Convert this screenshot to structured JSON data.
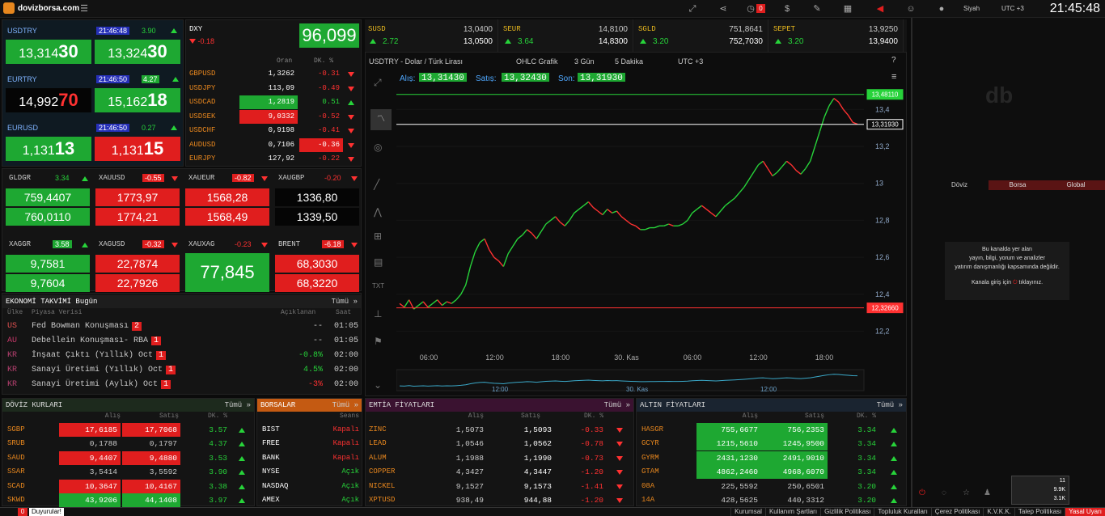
{
  "top": {
    "site": "dovizborsa.com",
    "theme": "Siyah",
    "tz": "UTC +3",
    "clock": "21:45:48",
    "alert_count": "0"
  },
  "usdtry": {
    "name": "USDTRY",
    "time": "21:46:48",
    "chg": "3.90",
    "bid_a": "13,314",
    "bid_b": "30",
    "ask_a": "13,324",
    "ask_b": "30"
  },
  "eurtry": {
    "name": "EURTRY",
    "time": "21:46:50",
    "chg": "4.27",
    "bid_a": "14,992",
    "bid_b": "70",
    "ask_a": "15,162",
    "ask_b": "18"
  },
  "eurusd": {
    "name": "EURUSD",
    "time": "21:46:50",
    "chg": "0.27",
    "bid_a": "1,131",
    "bid_b": "13",
    "ask_a": "1,131",
    "ask_b": "15"
  },
  "dxy": {
    "name": "DXY",
    "chg": "-0.18",
    "value": "96,099",
    "col_rate": "Oran",
    "col_chg": "DK. %"
  },
  "pairs": [
    {
      "n": "GBPUSD",
      "v": "1,3262",
      "c": "-0.31",
      "d": "dn",
      "hl": ""
    },
    {
      "n": "USDJPY",
      "v": "113,09",
      "c": "-0.49",
      "d": "dn",
      "hl": ""
    },
    {
      "n": "USDCAD",
      "v": "1,2819",
      "c": "0.51",
      "d": "up",
      "hl": "g"
    },
    {
      "n": "USDSEK",
      "v": "9,0332",
      "c": "-0.52",
      "d": "dn",
      "hl": "r"
    },
    {
      "n": "USDCHF",
      "v": "0,9198",
      "c": "-0.41",
      "d": "dn",
      "hl": ""
    },
    {
      "n": "AUDUSD",
      "v": "0,7106",
      "c": "-0.36",
      "d": "dn",
      "hl": "rc"
    },
    {
      "n": "EURJPY",
      "v": "127,92",
      "c": "-0.22",
      "d": "dn",
      "hl": ""
    }
  ],
  "metals": [
    {
      "n": "GLDGR",
      "c": "3.34",
      "d": "up",
      "b": "759,4407",
      "a": "760,0110",
      "cls": "g"
    },
    {
      "n": "XAUUSD",
      "c": "-0.55",
      "d": "dn",
      "b": "1773,97",
      "a": "1774,21",
      "cls": "r"
    },
    {
      "n": "XAUEUR",
      "c": "-0.82",
      "d": "dn",
      "b": "1568,28",
      "a": "1568,49",
      "cls": "r"
    },
    {
      "n": "XAUGBP",
      "c": "-0.20",
      "d": "dn",
      "b": "1336,80",
      "a": "1339,50",
      "cls": "k"
    }
  ],
  "metals2": [
    {
      "n": "XAGGR",
      "c": "3.58",
      "d": "up",
      "b": "9,7581",
      "a": "9,7604",
      "cls": "g"
    },
    {
      "n": "XAGUSD",
      "c": "-0.32",
      "d": "dn",
      "b": "22,7874",
      "a": "22,7926",
      "cls": "r"
    },
    {
      "n": "XAUXAG",
      "c": "-0.23",
      "d": "dn",
      "single": "77,845",
      "cls": "g"
    },
    {
      "n": "BRENT",
      "c": "-6.18",
      "d": "dn",
      "b": "68,3030",
      "a": "68,3220",
      "cls": "r"
    }
  ],
  "calendar": {
    "title": "EKONOMİ TAKVİMİ Bugün",
    "more": "Tümü »",
    "cols": [
      "Ülke",
      "Piyasa Verisi",
      "Açıklanan",
      "Saat"
    ],
    "rows": [
      {
        "c": "US",
        "e": "Fed Bowman Konuşması",
        "i": "2",
        "v": "--",
        "t": "01:05",
        "vc": ""
      },
      {
        "c": "AU",
        "e": "Debellein Konuşması- RBA",
        "i": "1",
        "v": "--",
        "t": "01:05",
        "vc": ""
      },
      {
        "c": "KR",
        "e": "İnşaat Çıktı (Yıllık) Oct",
        "i": "1",
        "v": "-0.8%",
        "t": "02:00",
        "vc": "up"
      },
      {
        "c": "KR",
        "e": "Sanayi Üretimi (Yıllık) Oct",
        "i": "1",
        "v": "4.5%",
        "t": "02:00",
        "vc": "up"
      },
      {
        "c": "KR",
        "e": "Sanayi Üretimi (Aylık) Oct",
        "i": "1",
        "v": "-3%",
        "t": "02:00",
        "vc": "dn"
      }
    ]
  },
  "quotes": [
    {
      "n": "SUSD",
      "c": "2.72",
      "v1": "13,0400",
      "v2": "13,0500"
    },
    {
      "n": "SEUR",
      "c": "3.64",
      "v1": "14,8100",
      "v2": "14,8300"
    },
    {
      "n": "SGLD",
      "c": "3.20",
      "v1": "751,8641",
      "v2": "752,7030"
    },
    {
      "n": "SEPET",
      "c": "3.20",
      "v1": "13,9250",
      "v2": "13,9400"
    }
  ],
  "chart_hdr": {
    "symbol": "USDTRY - Dolar / Türk Lirası",
    "type": "OHLC Grafik",
    "range": "3 Gün",
    "interval": "5 Dakika",
    "tz": "UTC +3",
    "bid_l": "Alış:",
    "bid": "13,31430",
    "ask_l": "Satış:",
    "ask": "13,32430",
    "last_l": "Son:",
    "last": "13,31930"
  },
  "chart_data": {
    "type": "line",
    "title": "USDTRY - Dolar / Türk Lirası",
    "xlabel": "",
    "ylabel": "",
    "x_ticks": [
      "06:00",
      "12:00",
      "18:00",
      "30. Kas",
      "06:00",
      "12:00",
      "18:00"
    ],
    "y_ticks": [
      "13,4",
      "13,2",
      "13",
      "12,8",
      "12,6",
      "12,4",
      "12,2"
    ],
    "ylim": [
      12.15,
      13.55
    ],
    "hlines": [
      {
        "label": "13,48110",
        "value": 13.4811
      },
      {
        "label": "13,31930",
        "value": 13.3193
      },
      {
        "label": "12,32660",
        "value": 12.3266
      }
    ],
    "series": [
      {
        "name": "",
        "values": [
          12.35,
          12.33,
          12.37,
          12.32,
          12.34,
          12.36,
          12.33,
          12.35,
          12.37,
          12.34,
          12.36,
          12.35,
          12.37,
          12.4,
          12.45,
          12.55,
          12.63,
          12.68,
          12.7,
          12.64,
          12.6,
          12.58,
          12.55,
          12.62,
          12.66,
          12.7,
          12.72,
          12.75,
          12.73,
          12.7,
          12.74,
          12.78,
          12.8,
          12.82,
          12.79,
          12.77,
          12.8,
          12.84,
          12.86,
          12.88,
          12.9,
          12.87,
          12.85,
          12.83,
          12.86,
          12.84,
          12.85,
          12.82,
          12.8,
          12.78,
          12.77,
          12.75,
          12.75,
          12.76,
          12.76,
          12.77,
          12.77,
          12.78,
          12.77,
          12.77,
          12.78,
          12.8,
          12.84,
          12.86,
          12.88,
          12.86,
          12.84,
          12.82,
          12.85,
          12.88,
          12.9,
          12.92,
          12.95,
          12.98,
          13.02,
          13.06,
          13.1,
          13.12,
          13.08,
          13.04,
          13.06,
          13.09,
          13.12,
          13.1,
          13.07,
          13.05,
          13.08,
          13.12,
          13.2,
          13.28,
          13.36,
          13.42,
          13.46,
          13.44,
          13.4,
          13.37,
          13.33,
          13.32
        ]
      }
    ],
    "navigator_ticks": [
      "12:00",
      "30. Kas",
      "12:00"
    ]
  },
  "sections": {
    "doviz": {
      "title": "DÖVİZ KURLARI",
      "more": "Tümü »",
      "cols": [
        "Alış",
        "Satış",
        "DK. %"
      ],
      "rows": [
        {
          "n": "SGBP",
          "b": "17,6185",
          "a": "17,7068",
          "c": "3.57",
          "cls": "r"
        },
        {
          "n": "SRUB",
          "b": "0,1788",
          "a": "0,1797",
          "c": "4.37",
          "cls": ""
        },
        {
          "n": "SAUD",
          "b": "9,4407",
          "a": "9,4880",
          "c": "3.53",
          "cls": "r"
        },
        {
          "n": "SSAR",
          "b": "3,5414",
          "a": "3,5592",
          "c": "3.90",
          "cls": ""
        },
        {
          "n": "SCAD",
          "b": "10,3647",
          "a": "10,4167",
          "c": "3.38",
          "cls": "r"
        },
        {
          "n": "SKWD",
          "b": "43,9206",
          "a": "44,1408",
          "c": "3.97",
          "cls": "g"
        }
      ]
    },
    "borsalar": {
      "title": "BORSALAR",
      "more": "Tümü »",
      "col": "Seans",
      "rows": [
        {
          "n": "BIST",
          "s": "Kapalı",
          "d": "dn"
        },
        {
          "n": "FREE",
          "s": "Kapalı",
          "d": "dn"
        },
        {
          "n": "BANK",
          "s": "Kapalı",
          "d": "dn"
        },
        {
          "n": "NYSE",
          "s": "Açık",
          "d": "up"
        },
        {
          "n": "NASDAQ",
          "s": "Açık",
          "d": "up"
        },
        {
          "n": "AMEX",
          "s": "Açık",
          "d": "up"
        }
      ]
    },
    "emtia": {
      "title": "EMTİA FİYATLARI",
      "more": "Tümü »",
      "cols": [
        "Alış",
        "Satış",
        "DK. %"
      ],
      "rows": [
        {
          "n": "ZINC",
          "b": "1,5073",
          "a": "1,5093",
          "c": "-0.33"
        },
        {
          "n": "LEAD",
          "b": "1,0546",
          "a": "1,0562",
          "c": "-0.78"
        },
        {
          "n": "ALUM",
          "b": "1,1988",
          "a": "1,1990",
          "c": "-0.73"
        },
        {
          "n": "COPPER",
          "b": "4,3427",
          "a": "4,3447",
          "c": "-1.20"
        },
        {
          "n": "NICKEL",
          "b": "9,1527",
          "a": "9,1573",
          "c": "-1.41"
        },
        {
          "n": "XPTUSD",
          "b": "938,49",
          "a": "944,88",
          "c": "-1.20"
        }
      ]
    },
    "altin": {
      "title": "ALTIN FİYATLARI",
      "more": "Tümü »",
      "cols": [
        "Alış",
        "Satış",
        "DK. %"
      ],
      "rows": [
        {
          "n": "HASGR",
          "b": "755,6677",
          "a": "756,2353",
          "c": "3.34",
          "cls": "g"
        },
        {
          "n": "GCYR",
          "b": "1215,5610",
          "a": "1245,9500",
          "c": "3.34",
          "cls": "g"
        },
        {
          "n": "GYRM",
          "b": "2431,1230",
          "a": "2491,9010",
          "c": "3.34",
          "cls": "g"
        },
        {
          "n": "GTAM",
          "b": "4862,2460",
          "a": "4968,6070",
          "c": "3.34",
          "cls": "g"
        },
        {
          "n": "08A",
          "b": "225,5592",
          "a": "250,6501",
          "c": "3.20",
          "cls": ""
        },
        {
          "n": "14A",
          "b": "428,5625",
          "a": "440,3312",
          "c": "3.20",
          "cls": ""
        }
      ]
    }
  },
  "chat": {
    "tabs": [
      "Döviz",
      "Borsa",
      "Global"
    ],
    "notice": [
      "Bu kanalda yer alan",
      "yayın, bilgi, yorum ve analizler",
      "yatırım danışmanlığı kapsamında değildir."
    ],
    "login": "Kanala giriş için",
    "login2": "tıklayınız."
  },
  "tray": {
    "a": "11",
    "b": "9.9K",
    "c": "3.1K"
  },
  "footer": {
    "count": "0",
    "ann": "Duyurular!",
    "links": [
      "Kurumsal",
      "Kullanım Şartları",
      "Gizlilik Politikası",
      "Topluluk Kuralları",
      "Çerez Politikası",
      "K.V.K.K.",
      "Talep Politikası",
      "Yasal Uyarı"
    ]
  }
}
